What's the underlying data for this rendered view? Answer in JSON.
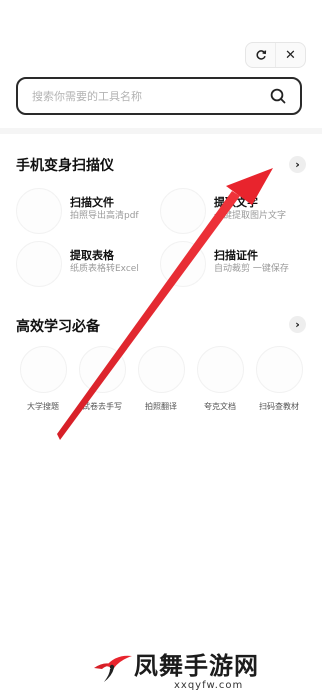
{
  "top_actions": {
    "refresh_icon": "refresh-icon",
    "close_glyph": "✕"
  },
  "search": {
    "placeholder": "搜索你需要的工具名称",
    "icon": "search-icon"
  },
  "section_scanner": {
    "title": "手机变身扫描仪",
    "more_glyph": "›",
    "tools": [
      {
        "name": "扫描文件",
        "desc": "拍照导出高清pdf"
      },
      {
        "name": "提取文字",
        "desc": "一键提取图片文字"
      },
      {
        "name": "提取表格",
        "desc": "纸质表格转Excel"
      },
      {
        "name": "扫描证件",
        "desc": "自动裁剪 一键保存"
      }
    ]
  },
  "section_study": {
    "title": "高效学习必备",
    "more_glyph": "›",
    "items": [
      {
        "label": "大学搜题"
      },
      {
        "label": "试卷去手写"
      },
      {
        "label": "拍照翻译"
      },
      {
        "label": "夸克文档"
      },
      {
        "label": "扫码查教材"
      }
    ]
  },
  "overlay": {
    "arrow_color": "#e8242d"
  },
  "watermark": {
    "text": "凤舞手游网",
    "url": "xxqyfw.com"
  }
}
